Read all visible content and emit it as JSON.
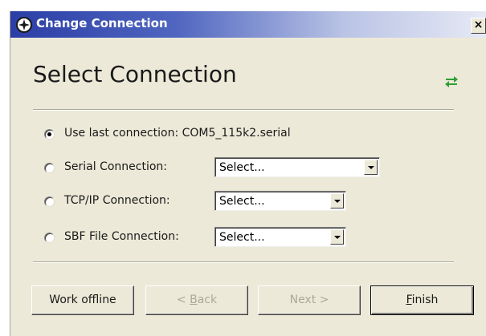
{
  "window": {
    "title": "Change Connection",
    "close_label": "×",
    "icon": "app-compass-icon"
  },
  "header": {
    "heading": "Select Connection",
    "icon": "swap-arrows-icon",
    "icon_color": "#2e9e33"
  },
  "options": [
    {
      "label": "Use last connection: COM5_115k2.serial",
      "checked": true
    },
    {
      "label": "Serial Connection:",
      "checked": false,
      "select_value": "Select..."
    },
    {
      "label": "TCP/IP Connection:",
      "checked": false,
      "select_value": "Select..."
    },
    {
      "label": "SBF File Connection:",
      "checked": false,
      "select_value": "Select..."
    }
  ],
  "buttons": {
    "offline": "Work offline",
    "back_prefix": "< ",
    "back_mnemonic": "B",
    "back_rest": "ack",
    "next": "Next >",
    "finish_mnemonic": "F",
    "finish_rest": "inish"
  }
}
